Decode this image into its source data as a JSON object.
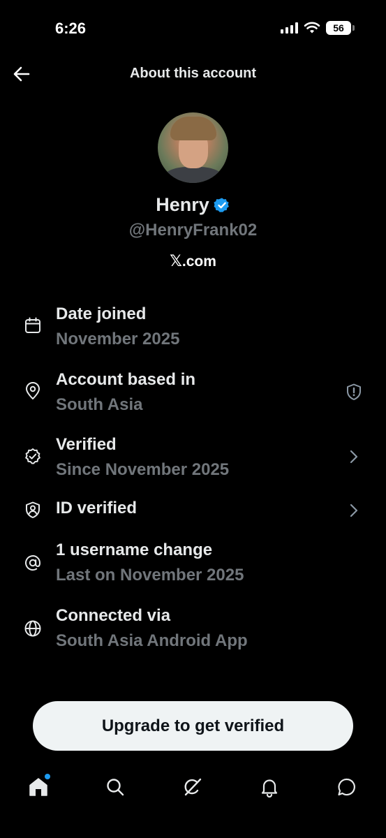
{
  "status_bar": {
    "time": "6:26",
    "battery": "56"
  },
  "header": {
    "title": "About this account"
  },
  "profile": {
    "display_name": "Henry",
    "handle": "@HenryFrank02",
    "domain_x": "𝕏",
    "domain_rest": ".com"
  },
  "info_items": [
    {
      "title": "Date joined",
      "subtitle": "November 2025",
      "icon": "calendar-icon"
    },
    {
      "title": "Account based in",
      "subtitle": "South Asia",
      "icon": "location-pin-icon",
      "action_icon": "shield-alert-icon"
    },
    {
      "title": "Verified",
      "subtitle": "Since November 2025",
      "icon": "verified-badge-outline-icon",
      "action_icon": "chevron-right-icon"
    },
    {
      "title": "ID verified",
      "subtitle": "",
      "icon": "id-shield-icon",
      "action_icon": "chevron-right-icon"
    },
    {
      "title": "1 username change",
      "subtitle": "Last on November 2025",
      "icon": "at-sign-icon"
    },
    {
      "title": "Connected via",
      "subtitle": "South Asia Android App",
      "icon": "globe-icon"
    }
  ],
  "upgrade_button": {
    "label": "Upgrade to get verified"
  },
  "bottom_nav": [
    {
      "icon": "home-icon",
      "has_notification_dot": true
    },
    {
      "icon": "search-icon"
    },
    {
      "icon": "grok-icon"
    },
    {
      "icon": "bell-icon"
    },
    {
      "icon": "messages-icon"
    }
  ],
  "colors": {
    "accent": "#1d9bf0",
    "background": "#000000",
    "secondary_text": "#71767b"
  }
}
